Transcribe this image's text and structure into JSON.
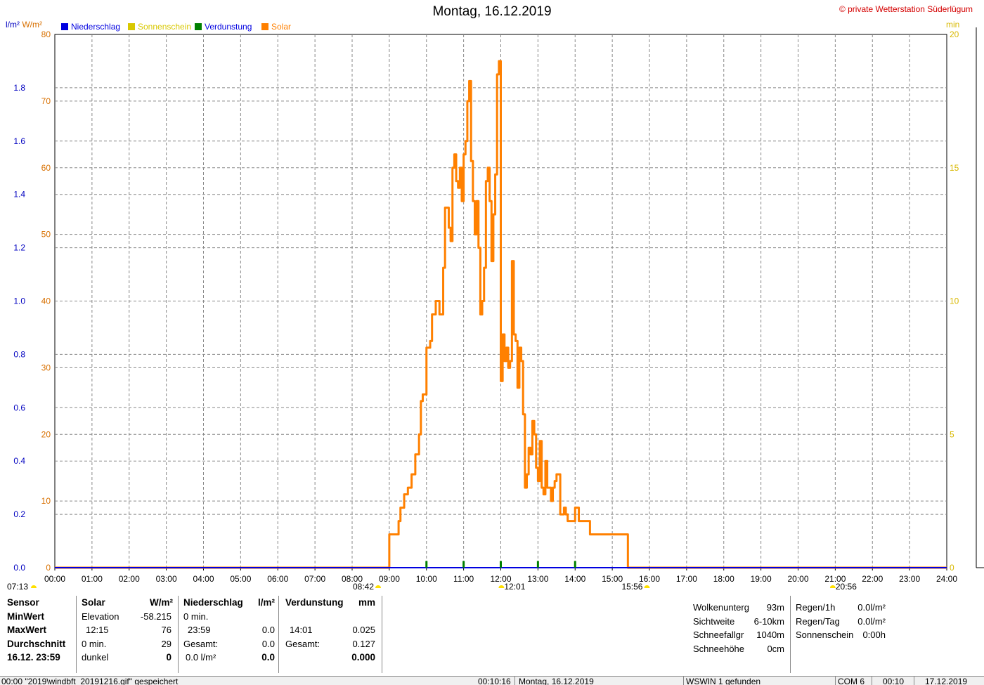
{
  "title": "Montag, 16.12.2019",
  "copyright": "© private Wetterstation Süderlügum",
  "units": {
    "left_l": "l/m²",
    "left_w": "W/m²",
    "right": "min"
  },
  "legend": [
    {
      "label": "Niederschlag",
      "color": "#0000e0"
    },
    {
      "label": "Sonnenschein",
      "color": "#d8c800"
    },
    {
      "label": "Verdunstung",
      "color": "#008000"
    },
    {
      "label": "Solar",
      "color": "#ff8000"
    }
  ],
  "sun_markers": {
    "sunrise": "07:13",
    "start": "08:42",
    "noon": "12:01",
    "end": "15:56",
    "sunset": "20:56"
  },
  "chart_data": {
    "type": "line",
    "x_ticks": [
      "00:00",
      "01:00",
      "02:00",
      "03:00",
      "04:00",
      "05:00",
      "06:00",
      "07:00",
      "08:00",
      "09:00",
      "10:00",
      "11:00",
      "12:00",
      "13:00",
      "14:00",
      "15:00",
      "16:00",
      "17:00",
      "18:00",
      "19:00",
      "20:00",
      "21:00",
      "22:00",
      "23:00",
      "24:00"
    ],
    "y_left_precip_ticks": [
      "0.0",
      "0.2",
      "0.4",
      "0.6",
      "0.8",
      "1.0",
      "1.2",
      "1.4",
      "1.6",
      "1.8"
    ],
    "y_left_solar_ticks": [
      "0",
      "10",
      "20",
      "30",
      "40",
      "50",
      "60",
      "70",
      "80"
    ],
    "y_right_ticks": [
      "0",
      "5",
      "10",
      "15",
      "20"
    ],
    "xlim_hours": [
      0,
      24
    ],
    "ylim_solar": [
      0,
      80
    ],
    "ylim_precip": [
      0,
      2.0
    ],
    "ylim_min": [
      0,
      20
    ],
    "grid": true,
    "series": [
      {
        "name": "Solar",
        "color": "#ff8000",
        "x_hours": [
          0,
          8.95,
          9.0,
          9.25,
          9.3,
          9.4,
          9.5,
          9.6,
          9.7,
          9.8,
          9.85,
          9.9,
          10.0,
          10.1,
          10.15,
          10.25,
          10.35,
          10.45,
          10.5,
          10.55,
          10.6,
          10.65,
          10.7,
          10.75,
          10.8,
          10.85,
          10.9,
          10.95,
          11.0,
          11.05,
          11.1,
          11.15,
          11.2,
          11.25,
          11.3,
          11.35,
          11.4,
          11.45,
          11.5,
          11.55,
          11.6,
          11.65,
          11.7,
          11.75,
          11.8,
          11.85,
          11.9,
          11.95,
          12.0,
          12.05,
          12.1,
          12.15,
          12.2,
          12.25,
          12.3,
          12.35,
          12.4,
          12.45,
          12.5,
          12.55,
          12.6,
          12.65,
          12.7,
          12.75,
          12.8,
          12.85,
          12.9,
          12.95,
          13.0,
          13.05,
          13.1,
          13.15,
          13.2,
          13.25,
          13.3,
          13.35,
          13.4,
          13.45,
          13.5,
          13.6,
          13.65,
          13.7,
          13.75,
          13.8,
          13.9,
          14.0,
          14.1,
          14.2,
          14.3,
          14.4,
          14.5,
          14.6,
          14.7,
          14.8,
          14.9,
          15.0,
          15.1,
          15.2,
          15.3,
          15.4,
          15.42,
          24
        ],
        "values": [
          0,
          0,
          5,
          7,
          9,
          11,
          12,
          14,
          17,
          20,
          25,
          26,
          33,
          34,
          38,
          40,
          38,
          45,
          54,
          54,
          51,
          49,
          60,
          62,
          58,
          57,
          60,
          55,
          62,
          64,
          70,
          73,
          61,
          55,
          50,
          55,
          48,
          38,
          40,
          45,
          58,
          60,
          55,
          46,
          53,
          59,
          74,
          76,
          28,
          35,
          31,
          33,
          30,
          31,
          46,
          35,
          34,
          27,
          33,
          31,
          23,
          12,
          14,
          18,
          17,
          22,
          20,
          15,
          13,
          19,
          12,
          11,
          16,
          12,
          12,
          10,
          12,
          13,
          14,
          8,
          8,
          9,
          8,
          7,
          7,
          9,
          7,
          7,
          7,
          5,
          5,
          5,
          5,
          5,
          5,
          5,
          5,
          5,
          5,
          5,
          0,
          0
        ]
      },
      {
        "name": "Niederschlag",
        "color": "#0000e0",
        "x_hours": [
          0,
          24
        ],
        "values": [
          0,
          0
        ]
      },
      {
        "name": "Verdunstung",
        "color": "#008000",
        "x_hours": [
          10.0,
          11.0,
          12.0,
          13.0,
          14.0
        ],
        "values": [
          0.025,
          0.025,
          0.025,
          0.025,
          0.025
        ]
      }
    ]
  },
  "table": {
    "col0": [
      "Sensor",
      "MinWert",
      "MaxWert",
      "Durchschnitt",
      "16.12. 23:59"
    ],
    "solar": {
      "header": "Solar",
      "unit": "W/m²",
      "rows": [
        [
          "Elevation",
          "-58.215"
        ],
        [
          "12:15",
          "76"
        ],
        [
          "0 min.",
          "29"
        ],
        [
          "dunkel",
          "0"
        ]
      ]
    },
    "niederschlag": {
      "header": "Niederschlag",
      "unit": "l/m²",
      "rows": [
        [
          "0 min.",
          ""
        ],
        [
          "23:59",
          "0.0"
        ],
        [
          "Gesamt:",
          "0.0"
        ],
        [
          "0.0 l/m²",
          "0.0"
        ]
      ]
    },
    "verdunstung": {
      "header": "Verdunstung",
      "unit": "mm",
      "rows": [
        [
          "",
          ""
        ],
        [
          "14:01",
          "0.025"
        ],
        [
          "Gesamt:",
          "0.127"
        ],
        [
          "",
          "0.000"
        ]
      ]
    },
    "wolken": [
      [
        "Wolkenunterg",
        "93m"
      ],
      [
        "Sichtweite",
        "6-10km"
      ],
      [
        "Schneefallgr",
        "1040m"
      ],
      [
        "Schneehöhe",
        "0cm"
      ]
    ],
    "regen": [
      [
        "Regen/1h",
        "0.0l/m²"
      ],
      [
        "Regen/Tag",
        "0.0l/m²"
      ],
      [
        "Sonnenschein",
        "0:00h"
      ]
    ]
  },
  "status": {
    "msg": "00:00 \"2019\\windbft_20191216.gif\" gespeichert",
    "time": "00:10:16",
    "date": "Montag, 16.12.2019",
    "found": "WSWIN 1 gefunden",
    "com": "COM 6",
    "clock": "00:10",
    "today": "17.12.2019"
  }
}
